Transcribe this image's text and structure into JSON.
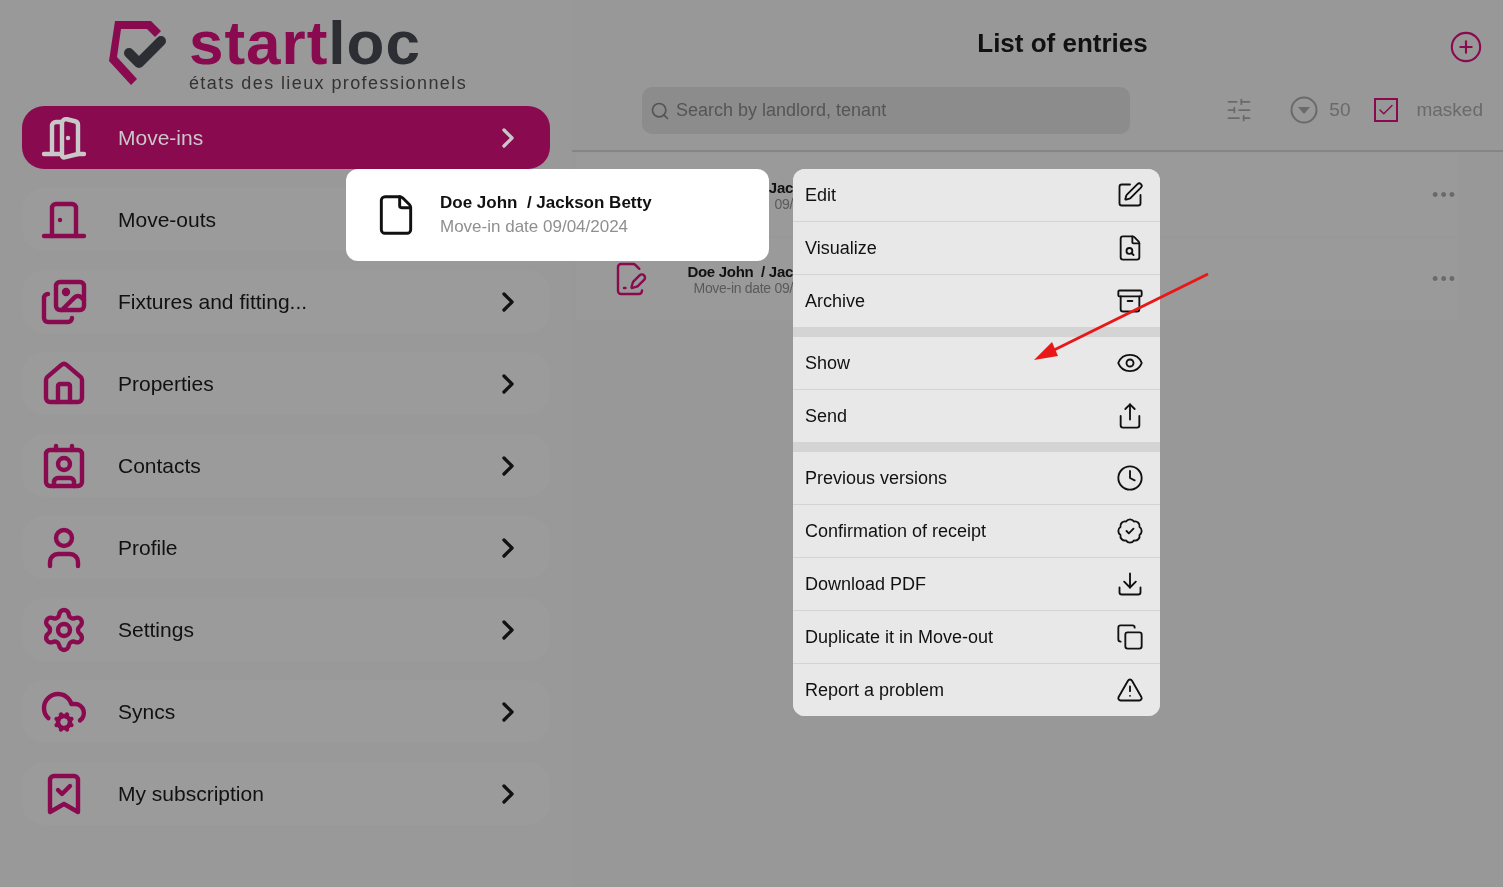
{
  "logo": {
    "brand_start": "start",
    "brand_end": "loc",
    "tagline": "états des lieux professionnels"
  },
  "sidebar": {
    "items": [
      {
        "label": "Move-ins",
        "selected": true,
        "chevron": true
      },
      {
        "label": "Move-outs",
        "selected": false,
        "chevron": false
      },
      {
        "label": "Fixtures and fitting...",
        "selected": false,
        "chevron": true
      },
      {
        "label": "Properties",
        "selected": false,
        "chevron": true
      },
      {
        "label": "Contacts",
        "selected": false,
        "chevron": true
      },
      {
        "label": "Profile",
        "selected": false,
        "chevron": true
      },
      {
        "label": "Settings",
        "selected": false,
        "chevron": true
      },
      {
        "label": "Syncs",
        "selected": false,
        "chevron": true
      },
      {
        "label": "My subscription",
        "selected": false,
        "chevron": true
      }
    ]
  },
  "header": {
    "title": "List of entries",
    "search": {
      "placeholder": "Search by landlord, tenant"
    },
    "page_size": "50",
    "masked": {
      "label": "masked",
      "checked": true
    }
  },
  "entries": [
    {
      "kind": "partial",
      "title": "Jac",
      "subtitle": "09/",
      "more": "•••"
    },
    {
      "kind": "full",
      "title": "Doe John  / Jac",
      "subtitle": "Move-in date 09/",
      "more": "•••"
    }
  ],
  "selected_entry": {
    "title": "Doe John  / Jackson Betty",
    "subtitle": "Move-in date 09/04/2024"
  },
  "context_menu": {
    "groups": [
      {
        "items": [
          {
            "label": "Edit"
          },
          {
            "label": "Visualize"
          },
          {
            "label": "Archive"
          }
        ]
      },
      {
        "items": [
          {
            "label": "Show"
          },
          {
            "label": "Send"
          }
        ]
      },
      {
        "items": [
          {
            "label": "Previous versions"
          },
          {
            "label": "Confirmation of receipt"
          },
          {
            "label": "Download PDF"
          },
          {
            "label": "Duplicate it in Move-out"
          },
          {
            "label": "Report a problem"
          }
        ]
      }
    ]
  }
}
